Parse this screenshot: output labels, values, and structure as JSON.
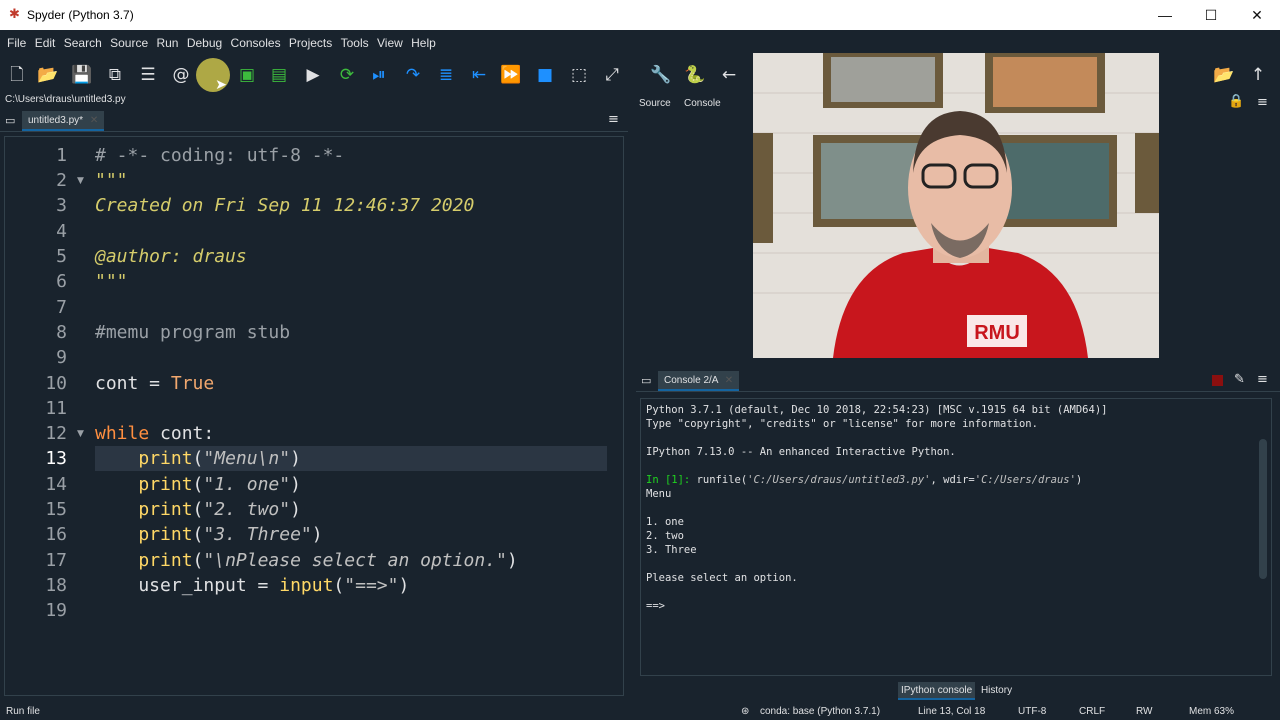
{
  "window": {
    "title": "Spyder (Python 3.7)",
    "minimize": "—",
    "maximize": "☐",
    "close": "✕"
  },
  "menu": [
    "File",
    "Edit",
    "Search",
    "Source",
    "Run",
    "Debug",
    "Consoles",
    "Projects",
    "Tools",
    "View",
    "Help"
  ],
  "toolbar_icons": [
    "new-file",
    "open-file",
    "save-file",
    "save-all",
    "browse-tabs",
    "at-sign",
    "run-file",
    "run-cell",
    "run-cell-advance",
    "run-selection",
    "re-run",
    "debug",
    "step",
    "step-into",
    "step-return",
    "continue",
    "stop-debug",
    "maximize-pane",
    "fullscreen",
    "preferences",
    "python-path",
    "back"
  ],
  "path": "C:\\Users\\draus\\untitled3.py",
  "editor": {
    "tab_label": "untitled3.py*",
    "current_line": 13,
    "line_numbers": [
      "1",
      "2",
      "3",
      "4",
      "5",
      "6",
      "7",
      "8",
      "9",
      "10",
      "11",
      "12",
      "13",
      "14",
      "15",
      "16",
      "17",
      "18",
      "19"
    ]
  },
  "right_top": {
    "tab_source": "Source",
    "tab_console": "Console"
  },
  "console": {
    "tab_label": "Console 2/A",
    "lines": [
      "Python 3.7.1 (default, Dec 10 2018, 22:54:23) [MSC v.1915 64 bit (AMD64)]",
      "Type \"copyright\", \"credits\" or \"license\" for more information.",
      "",
      "IPython 7.13.0 -- An enhanced Interactive Python.",
      "",
      "",
      "Menu",
      "",
      "1. one",
      "2. two",
      "3. Three",
      "",
      "Please select an option.",
      "",
      "==>"
    ],
    "prompt": "In [1]:",
    "runfile_cmd": "runfile(",
    "runfile_arg1": "'C:/Users/draus/untitled3.py'",
    "runfile_mid": ", wdir=",
    "runfile_arg2": "'C:/Users/draus'",
    "runfile_end": ")"
  },
  "bottom_tabs": {
    "ipython": "IPython console",
    "history": "History"
  },
  "statusbar": {
    "left": "Run file",
    "conda": "conda: base (Python 3.7.1)",
    "position": "Line 13, Col 18",
    "encoding": "UTF-8",
    "eol": "CRLF",
    "rw": "RW",
    "mem": "Mem 63%"
  },
  "webcam": {
    "shirt_text": "RMU"
  },
  "colors": {
    "background": "#19232d",
    "tab_active": "#32414b",
    "accent": "#1464a0",
    "keyword": "#ff8f40",
    "docstring": "#d5cc6b",
    "prompt": "#1fd31f"
  }
}
